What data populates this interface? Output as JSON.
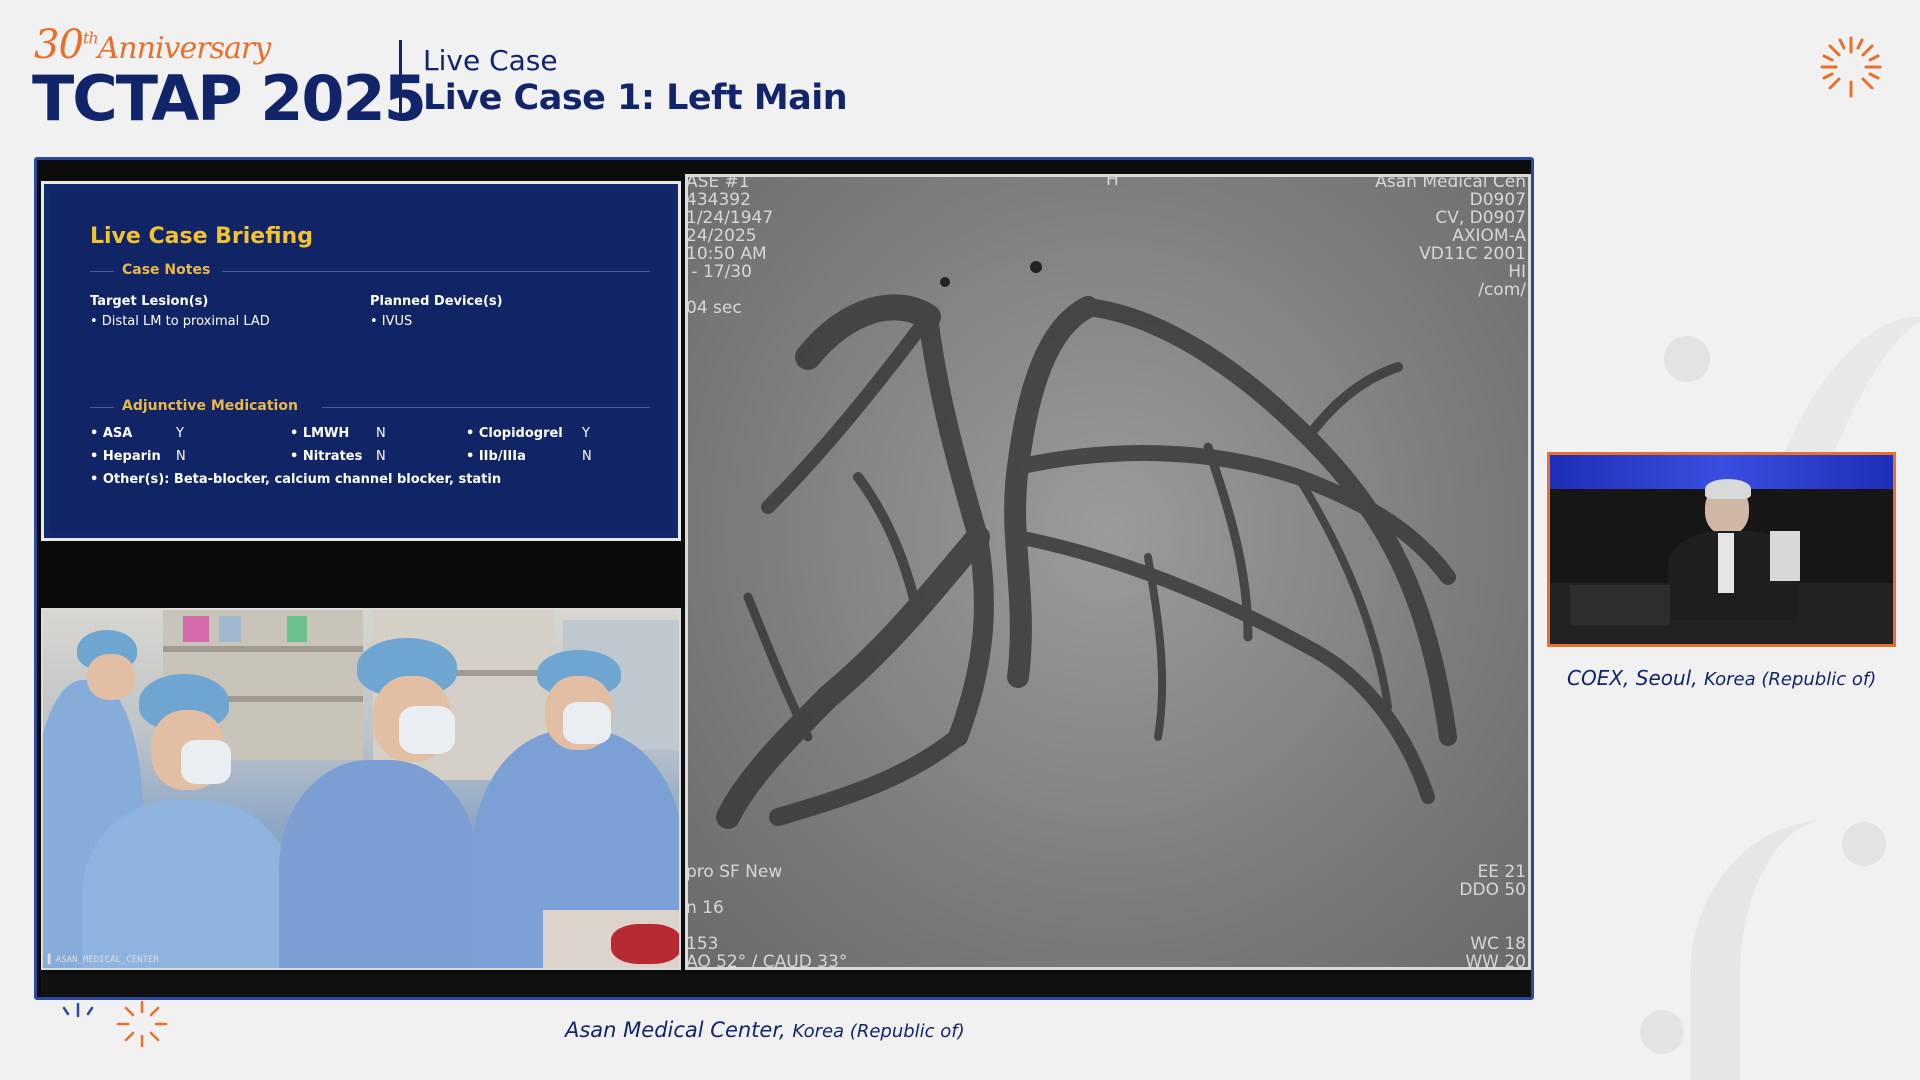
{
  "header": {
    "anniversary_number": "30",
    "anniversary_suffix": "th",
    "anniversary_word": "Anniversary",
    "brand": "TCTAP 2025",
    "section_label": "Live Case",
    "session_title": "Live Case 1: Left Main"
  },
  "slide": {
    "title": "Live Case Briefing",
    "case_notes_label": "Case Notes",
    "target_lesion_heading": "Target Lesion(s)",
    "target_lesion_value": "•  Distal LM to proximal LAD",
    "planned_device_heading": "Planned Device(s)",
    "planned_device_value": "•  IVUS",
    "adjunctive_label": "Adjunctive Medication",
    "meds": [
      {
        "name": "• ASA",
        "value": "Y"
      },
      {
        "name": "• LMWH",
        "value": "N"
      },
      {
        "name": "• Clopidogrel",
        "value": "Y"
      },
      {
        "name": "• Heparin",
        "value": "N"
      },
      {
        "name": "• Nitrates",
        "value": "N"
      },
      {
        "name": "• IIb/IIIa",
        "value": "N"
      }
    ],
    "others": "• Other(s): Beta-blocker, calcium channel blocker, statin"
  },
  "angio_overlay": {
    "top_left": "ASE #1\n434392\n1/24/1947\n24/2025\n10:50 AM\n - 17/30\n\n04 sec",
    "top_right": "Asan Medical Cen\nD0907\nCV, D0907\nAXIOM-A\nVD11C 2001\nHI\n/com/",
    "bottom_left": "pro SF New\n\nn 16\n\n153\nAO 52° / CAUD 33°",
    "bottom_right": "EE 21\nDDO 50\n\n\nWC 18\nWW 20",
    "marker": "H"
  },
  "camera_label": "▐ ASAN_MEDICAL_CENTER",
  "main_caption": {
    "place": "Asan Medical Center,",
    "country": "Korea (Republic of)"
  },
  "side_caption": {
    "place": "COEX, Seoul,",
    "country": "Korea (Republic of)"
  },
  "colors": {
    "brand_navy": "#12256b",
    "accent_orange": "#e8702a",
    "slide_bg": "#102466",
    "slide_title": "#f1c232",
    "frame_border": "#2d4a9a"
  }
}
